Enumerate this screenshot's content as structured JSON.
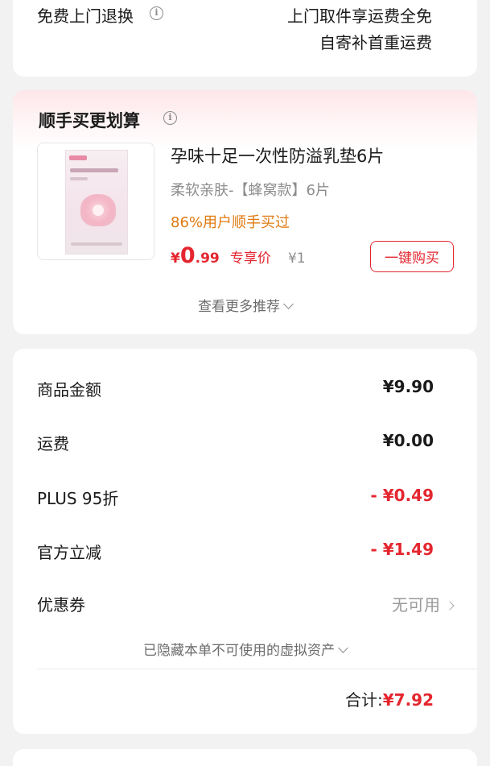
{
  "return_service": {
    "label": "免费上门退换",
    "desc_line1": "上门取件享运费全免",
    "desc_line2": "自寄补首重运费"
  },
  "addon": {
    "title": "顺手买更划算",
    "product": {
      "name": "孕味十足一次性防溢乳垫6片",
      "spec": "柔软亲肤-【蜂窝款】6片",
      "stat": "86%用户顺手买过",
      "price_currency": "¥",
      "price_integer": "0",
      "price_decimal": ".99",
      "price_tag": "专享价",
      "original_price": "¥1",
      "buy_label": "一键购买"
    },
    "more_label": "查看更多推荐"
  },
  "summary": {
    "rows": [
      {
        "label": "商品金额",
        "value": "¥9.90"
      },
      {
        "label": "运费",
        "value": "¥0.00"
      },
      {
        "label": "PLUS 95折",
        "value": "- ¥0.49"
      },
      {
        "label": "官方立减",
        "value": "- ¥1.49"
      },
      {
        "label": "优惠券",
        "value": "无可用"
      }
    ],
    "hidden_note": "已隐藏本单不可使用的虚拟资产",
    "total_label": "合计:",
    "total_value": "¥7.92"
  },
  "colors": {
    "accent_red": "#e4262f",
    "stat_orange": "#e07a10",
    "background": "#f2f2f2"
  }
}
